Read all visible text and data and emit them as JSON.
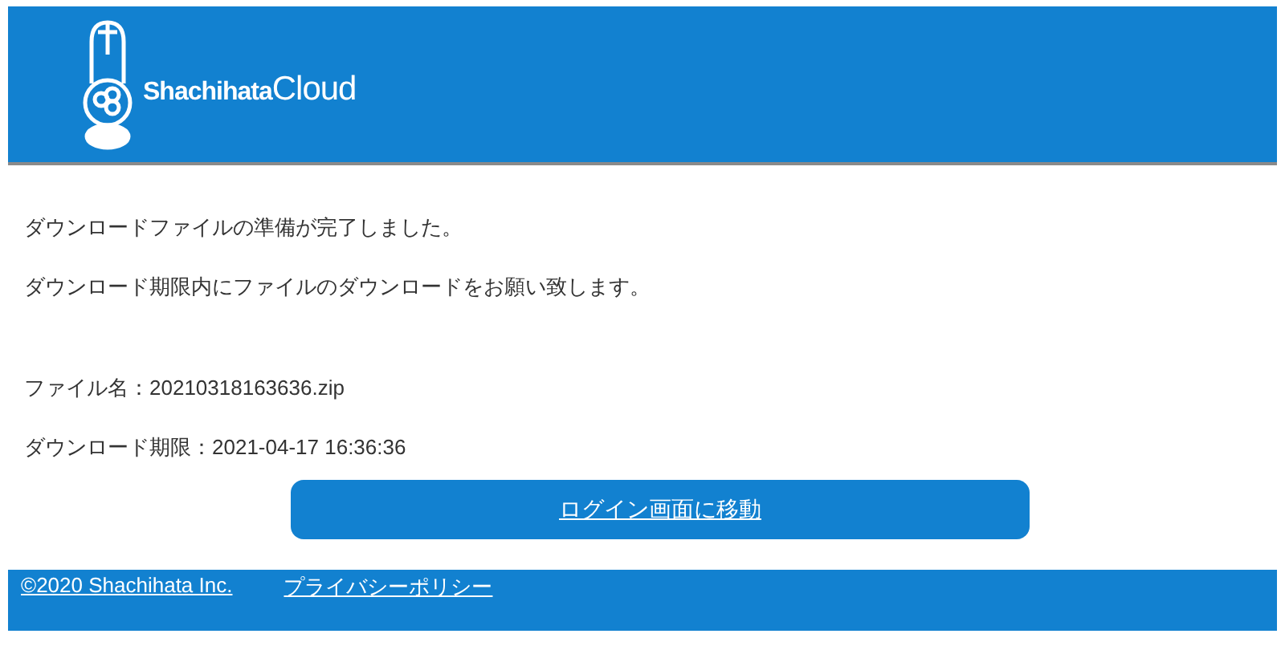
{
  "header": {
    "logo": {
      "brand": "Shachihata",
      "product": "Cloud"
    }
  },
  "messages": [
    "ダウンロードファイルの準備が完了しました。",
    "ダウンロード期限内にファイルのダウンロードをお願い致します。"
  ],
  "details": [
    "ファイル名：20210318163636.zip",
    "ダウンロード期限：2021-04-17 16:36:36"
  ],
  "button": {
    "label": "ログイン画面に移動"
  },
  "footer": {
    "links": [
      "©2020 Shachihata Inc.",
      "プライバシーポリシー"
    ]
  }
}
